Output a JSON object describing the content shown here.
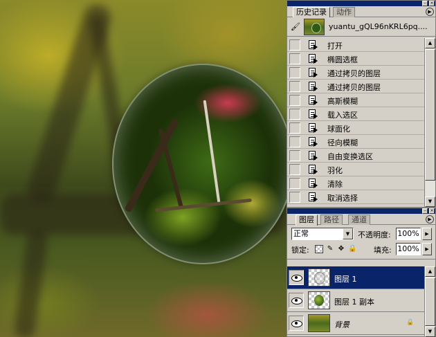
{
  "history_panel": {
    "tabs": [
      "历史记录",
      "动作"
    ],
    "snapshot_name": "yuantu_gQL96nKRL6pq....",
    "items": [
      {
        "label": "打开"
      },
      {
        "label": "椭圆选框"
      },
      {
        "label": "通过拷贝的图层"
      },
      {
        "label": "通过拷贝的图层"
      },
      {
        "label": "高斯模糊"
      },
      {
        "label": "载入选区"
      },
      {
        "label": "球面化"
      },
      {
        "label": "径向模糊"
      },
      {
        "label": "自由变换选区"
      },
      {
        "label": "羽化"
      },
      {
        "label": "清除"
      },
      {
        "label": "取消选择"
      }
    ]
  },
  "layers_panel": {
    "tabs": [
      "图层",
      "路径",
      "通道"
    ],
    "blend_mode": "正常",
    "opacity_label": "不透明度:",
    "opacity_value": "100%",
    "lock_label": "锁定:",
    "fill_label": "填充:",
    "fill_value": "100%",
    "layers": [
      {
        "name": "图层 1",
        "selected": true
      },
      {
        "name": "图层 1 副本",
        "selected": false
      },
      {
        "name": "背景",
        "selected": false,
        "locked": true
      }
    ]
  },
  "colors": {
    "selection": "#0a246a",
    "panel_bg": "#d4d0c8"
  }
}
